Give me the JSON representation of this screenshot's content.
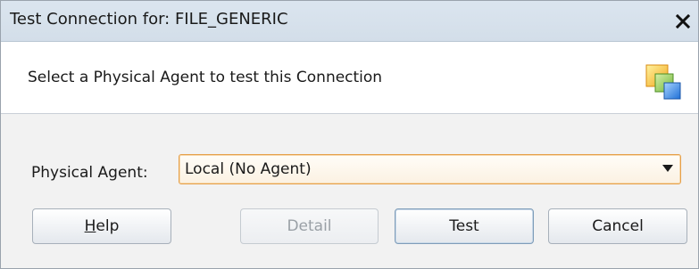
{
  "window": {
    "title": "Test Connection for: FILE_GENERIC",
    "close_glyph": "✕"
  },
  "header": {
    "instruction": "Select a Physical Agent to test this Connection",
    "icon": "connection-wizard-icon"
  },
  "form": {
    "agent_label": "Physical Agent:",
    "agent_value": "Local (No Agent)"
  },
  "buttons": {
    "help_mnemonic": "H",
    "help_rest": "elp",
    "detail": "Detail",
    "test": "Test",
    "cancel": "Cancel"
  },
  "colors": {
    "title_bar": "#d3dee9",
    "select_border": "#e6a04a",
    "disabled_text": "#9aa0a6"
  }
}
